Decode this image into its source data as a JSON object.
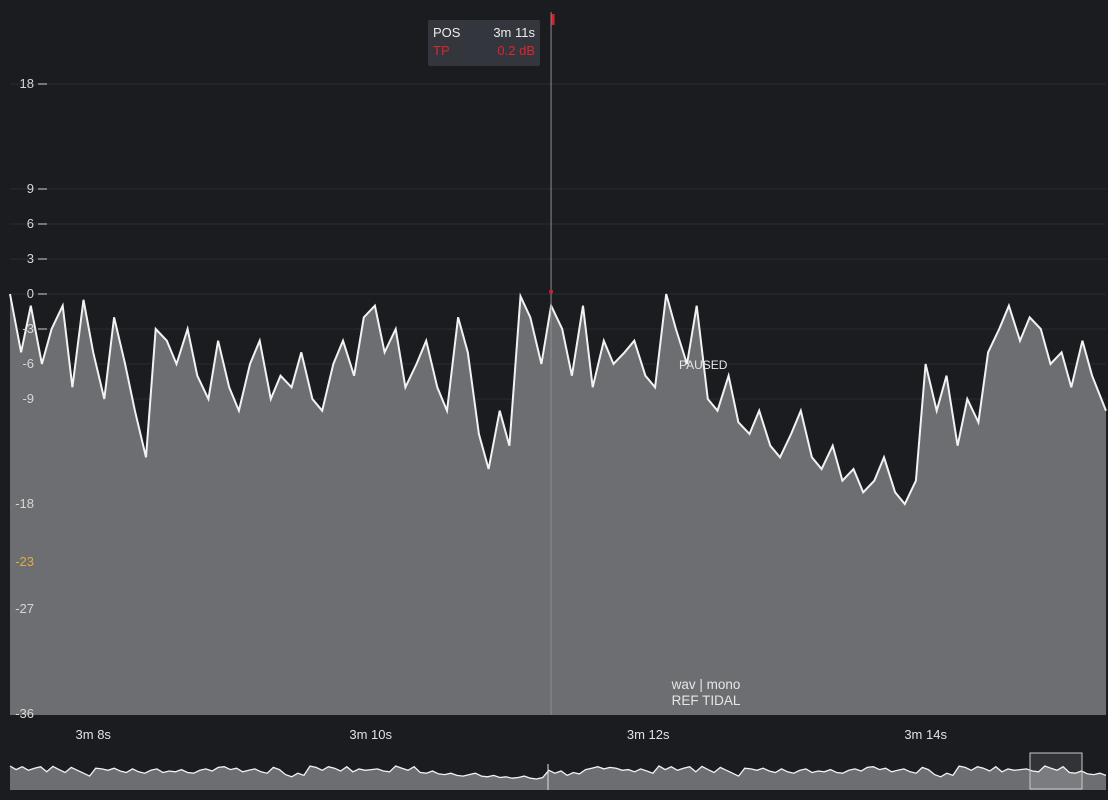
{
  "tooltip": {
    "pos_label": "POS",
    "pos_value": "3m 11s",
    "tp_label": "TP",
    "tp_value": "0.2 dB"
  },
  "status": {
    "paused_label": "PAUSED"
  },
  "file_info": {
    "format_line": "wav | mono",
    "ref_line": "REF TIDAL"
  },
  "colors": {
    "background": "#1b1c20",
    "area_fill": "#6d6e71",
    "line": "#f2f2f2",
    "playhead": "#d71f27",
    "tp_text": "#e0242b",
    "target_tick": "#e3ad3d"
  },
  "chart_data": {
    "type": "area",
    "ylabel": "",
    "xlabel": "",
    "ylim": [
      -36,
      20
    ],
    "y_ticks": [
      {
        "label": "18",
        "value": 18,
        "highlight": false
      },
      {
        "label": "9",
        "value": 9,
        "highlight": false
      },
      {
        "label": "6",
        "value": 6,
        "highlight": false
      },
      {
        "label": "3",
        "value": 3,
        "highlight": false
      },
      {
        "label": "0",
        "value": 0,
        "highlight": false
      },
      {
        "label": "-3",
        "value": -3,
        "highlight": false
      },
      {
        "label": "-6",
        "value": -6,
        "highlight": false
      },
      {
        "label": "-9",
        "value": -9,
        "highlight": false
      },
      {
        "label": "-18",
        "value": -18,
        "highlight": false
      },
      {
        "label": "-23",
        "value": -23,
        "highlight": true
      },
      {
        "label": "-27",
        "value": -27,
        "highlight": false
      },
      {
        "label": "-36",
        "value": -36,
        "highlight": false
      }
    ],
    "x_ticks": [
      {
        "label": "3m 8s",
        "value": 188
      },
      {
        "label": "3m 10s",
        "value": 190
      },
      {
        "label": "3m 12s",
        "value": 192
      },
      {
        "label": "3m 14s",
        "value": 194
      }
    ],
    "xlim_seconds": [
      187.4,
      195.3
    ],
    "playhead_seconds": 191.3,
    "series": [
      {
        "x": [
          187.4,
          187.48,
          187.55,
          187.63,
          187.7,
          187.78,
          187.85,
          187.93,
          188.0,
          188.08,
          188.15,
          188.23,
          188.3,
          188.38,
          188.45,
          188.53,
          188.6,
          188.68,
          188.75,
          188.83,
          188.9,
          188.98,
          189.05,
          189.13,
          189.2,
          189.28,
          189.35,
          189.43,
          189.5,
          189.58,
          189.65,
          189.73,
          189.8,
          189.88,
          189.95,
          190.03,
          190.1,
          190.18,
          190.25,
          190.33,
          190.4,
          190.48,
          190.55,
          190.63,
          190.7,
          190.78,
          190.85,
          190.93,
          191.0,
          191.08,
          191.15,
          191.23,
          191.3,
          191.38,
          191.45,
          191.53,
          191.6,
          191.68,
          191.75,
          191.83,
          191.9,
          191.98,
          192.05,
          192.13,
          192.2,
          192.28,
          192.35,
          192.43,
          192.5,
          192.58,
          192.65,
          192.73,
          192.8,
          192.88,
          192.95,
          193.03,
          193.1,
          193.18,
          193.25,
          193.33,
          193.4,
          193.48,
          193.55,
          193.63,
          193.7,
          193.78,
          193.85,
          193.93,
          194.0,
          194.08,
          194.15,
          194.23,
          194.3,
          194.38,
          194.45,
          194.53,
          194.6,
          194.68,
          194.75,
          194.83,
          194.9,
          194.98,
          195.05,
          195.13,
          195.2,
          195.3
        ],
        "values": [
          0,
          -5,
          -1,
          -6,
          -3,
          -1,
          -8,
          -0.5,
          -5,
          -9,
          -2,
          -6,
          -10,
          -14,
          -3,
          -4,
          -6,
          -3,
          -7,
          -9,
          -4,
          -8,
          -10,
          -6,
          -4,
          -9,
          -7,
          -8,
          -5,
          -9,
          -10,
          -6,
          -4,
          -7,
          -2,
          -1,
          -5,
          -3,
          -8,
          -6,
          -4,
          -8,
          -10,
          -2,
          -5,
          -12,
          -15,
          -10,
          -13,
          -0.2,
          -2,
          -6,
          -1,
          -3,
          -7,
          -1,
          -8,
          -4,
          -6,
          -5,
          -4,
          -7,
          -8,
          0,
          -3,
          -6,
          -1,
          -9,
          -10,
          -7,
          -11,
          -12,
          -10,
          -13,
          -14,
          -12,
          -10,
          -14,
          -15,
          -13,
          -16,
          -15,
          -17,
          -16,
          -14,
          -17,
          -18,
          -16,
          -6,
          -10,
          -7,
          -13,
          -9,
          -11,
          -5,
          -3,
          -1,
          -4,
          -2,
          -3,
          -6,
          -5,
          -8,
          -4,
          -7,
          -10
        ],
        "min_seconds": 191.15,
        "min_value": -15
      }
    ]
  }
}
